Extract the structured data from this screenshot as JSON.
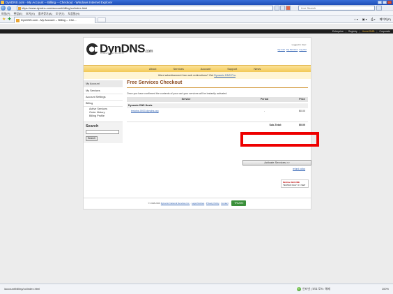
{
  "browser": {
    "window_title": "DynDNS.com - My Account -- Billing -- Checkout - Windows Internet Explorer",
    "address": "https://www.dyndns.com/account/billing/co/index.html",
    "live_search_placeholder": "Live Search",
    "menu": [
      "파일(F)",
      "편집(E)",
      "보기(V)",
      "즐겨찾기(A)",
      "도구(T)",
      "도움말(H)"
    ],
    "tab_title": "DynDNS.com - My Account -- Billing -- Che...",
    "command_bar": [
      "페이지(P)"
    ],
    "status_text": "/account/billing/co/index.html",
    "zone_text": "인터넷 | 보호 모드: 해제",
    "zoom": "100%"
  },
  "site": {
    "top_nav": [
      "Enterprise",
      "Registry",
      "Home/SMB",
      "Corporate"
    ],
    "logo": {
      "main": "DynDNS",
      "suffix": ".com",
      "tagline": "Dynamic Network Services Inc."
    },
    "login": {
      "status": "Logged In User:",
      "links": [
        "My Cart",
        "My Services",
        "Log Out"
      ]
    },
    "main_nav": [
      "About",
      "Services",
      "Account",
      "Support",
      "News"
    ],
    "promo": {
      "text": "Want advertisement free web redirections? Get ",
      "link": "Dynamic DNS Pro",
      "suffix": "."
    },
    "sidebar": {
      "header": "My Account",
      "items": [
        "My Services",
        "Account Settings"
      ],
      "billing_header": "Billing",
      "billing_items": [
        "Active Services",
        "Order History",
        "Billing Profile"
      ],
      "search_title": "Search",
      "search_button": "Search"
    },
    "checkout": {
      "title": "Free Services Checkout",
      "intro": "Once you have confirmed the contents of your cart your services will be instantly activated.",
      "columns": {
        "service": "Service",
        "period": "Period",
        "price": "Price"
      },
      "section": "Dynamic DNS Hosts",
      "rows": [
        {
          "service": "testdns-0033.dyndns.org",
          "period": "-",
          "price": "$0.00"
        }
      ],
      "subtotal_label": "Sub-Total:",
      "subtotal_value": "$0.00",
      "activate_button": "Activate Services >>",
      "refund_link": "refund policy",
      "mcafee": {
        "title": "McAfee SECURE",
        "subtitle": "TESTED DAILY",
        "date": "17-SEP"
      }
    },
    "footer": {
      "copyright": "© 1998-2009 ",
      "company_link": "Dynamic Network Services Inc.",
      "links": [
        "Legal Notices",
        "Privacy Policy",
        "Contact"
      ],
      "truste": "TRUSTe"
    }
  },
  "colors": {
    "highlight": "#ee0000",
    "nav_bar": "#f3c956",
    "link": "#2a5db0",
    "title": "#8a4a1f"
  }
}
